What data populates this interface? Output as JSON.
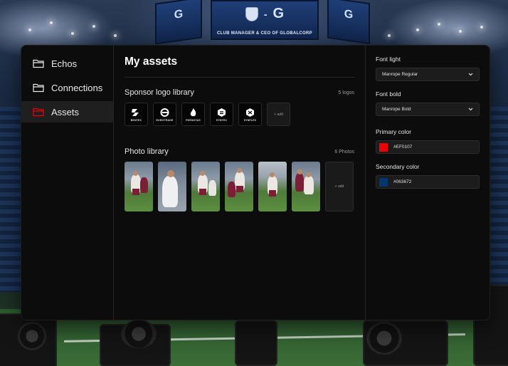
{
  "background": {
    "screen_caption": "CLUB MANAGER & CEO OF GLOBALCORP",
    "screen_letter": "G"
  },
  "sidebar": {
    "items": [
      {
        "label": "Echos",
        "icon": "folder-icon",
        "active": false
      },
      {
        "label": "Connections",
        "icon": "folder-icon",
        "active": false
      },
      {
        "label": "Assets",
        "icon": "folder-icon",
        "active": true
      }
    ]
  },
  "main": {
    "title": "My assets",
    "sponsor": {
      "title": "Sponsor logo library",
      "count": "5 logos",
      "logos": [
        {
          "name": "BENTEC",
          "icon": "bentec-logo-icon"
        },
        {
          "name": "EUROTRADE",
          "icon": "eurotrade-logo-icon"
        },
        {
          "name": "PHENOTAS",
          "icon": "flame-logo-icon"
        },
        {
          "name": "SYNTEC",
          "icon": "syntec-logo-icon"
        },
        {
          "name": "SYNFLEX",
          "icon": "synflex-logo-icon"
        }
      ],
      "add_label": "+ add"
    },
    "photos": {
      "title": "Photo library",
      "count": "6 Photos",
      "add_label": "+ add"
    }
  },
  "panel": {
    "font_light": {
      "label": "Font light",
      "value": "Manrope Regular"
    },
    "font_bold": {
      "label": "Font bold",
      "value": "Manrope Bold"
    },
    "primary_color": {
      "label": "Primary color",
      "value": "#EF0107",
      "hex": "#EF0107"
    },
    "secondary_color": {
      "label": "Secondary color",
      "value": "#063672",
      "hex": "#063672"
    }
  },
  "accent_color": "#EF0107"
}
